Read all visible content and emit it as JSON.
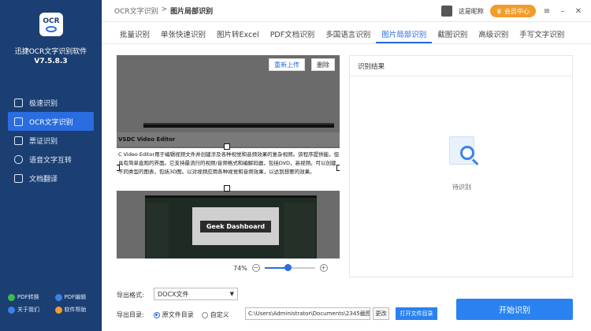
{
  "sidebar": {
    "logo_text": "OCR",
    "app_name": "迅捷OCR文字识别软件",
    "version": "V7.5.8.3",
    "items": [
      {
        "label": "极速识别",
        "icon": "crop-icon"
      },
      {
        "label": "OCR文字识别",
        "icon": "ocr-icon",
        "active": true
      },
      {
        "label": "票证识别",
        "icon": "ticket-icon"
      },
      {
        "label": "语音文字互转",
        "icon": "mic-icon"
      },
      {
        "label": "文档翻译",
        "icon": "translate-icon"
      }
    ],
    "bottom": [
      {
        "label": "PDF转换",
        "color": "#3fb950"
      },
      {
        "label": "PDF编辑",
        "color": "#3b82e8"
      },
      {
        "label": "关于我们",
        "color": "#3b82e8"
      },
      {
        "label": "软件帮助",
        "color": "#f29c2b"
      }
    ]
  },
  "topbar": {
    "breadcrumb_root": "OCR文字识别",
    "breadcrumb_sep": ">",
    "breadcrumb_current": "图片局部识别",
    "username": "这是昵称",
    "vip_label": "会员中心",
    "window_controls": [
      "≡",
      "–",
      "✕"
    ]
  },
  "tabs": [
    {
      "label": "批量识别"
    },
    {
      "label": "单张快速识别"
    },
    {
      "label": "图片转Excel"
    },
    {
      "label": "PDF文档识别"
    },
    {
      "label": "多国语言识别"
    },
    {
      "label": "图片局部识别",
      "active": true
    },
    {
      "label": "截图识别"
    },
    {
      "label": "高级识别"
    },
    {
      "label": "手写文字识别"
    }
  ],
  "image_panel": {
    "reupload_label": "重新上传",
    "delete_label": "删除",
    "sheet_title": "VSDC Video Editor",
    "selected_text": "C Video Editor用于编辑视频文件并创建涉及各种视觉和音频效果的复杂视频。该程序提供能，但具有简单直观的界面。它支持最流行的视频/音频格式和编解码器，包括DVD，高视频。可以创建不同类型的图表，包括3D图。以对视频应用各种视觉和音频效果，以达到想要的效果。",
    "video_title": "Geek Dashboard",
    "zoom_label": "74%",
    "zoom_level": 0.45
  },
  "result_panel": {
    "title": "识别结果",
    "empty_text": "待识别"
  },
  "bottom": {
    "format_label": "导出格式:",
    "format_value": "DOCX文件",
    "dir_label": "导出目录:",
    "radio_original": "原文件目录",
    "radio_custom": "自定义",
    "path_value": "C:\\Users\\Administrator\\Documents\\2345截图",
    "change_label": "更改",
    "open_dir_label": "打开文件目录",
    "start_label": "开始识别"
  }
}
